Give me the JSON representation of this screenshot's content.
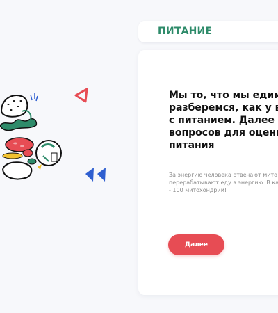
{
  "section": {
    "title": "ПИТАНИЕ"
  },
  "content": {
    "heading": "Мы то, что мы едим. Да\nразберемся, как у вас\nс питанием. Далее буд\nвопросов для оценки п\nпитания",
    "body": "За энергию человека отвечают мито\nперерабатывают еду в энергию. В ка\n- 100 митохондрий!"
  },
  "actions": {
    "next_label": "Далее"
  },
  "colors": {
    "accent_green": "#2e8b6a",
    "accent_red": "#e74c54",
    "accent_blue": "#2f5fd0"
  },
  "icons": {
    "food": "food-illustration",
    "triangle_left": "triangle-outline-icon",
    "double_arrow": "double-arrow-left-icon"
  }
}
